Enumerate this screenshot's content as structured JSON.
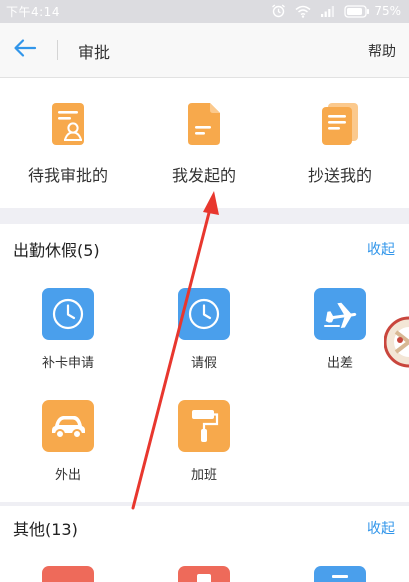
{
  "status_bar": {
    "time": "下午4:14",
    "battery": "75%",
    "icons": [
      "alarm-icon",
      "wifi-icon",
      "signal-icon",
      "battery-icon"
    ]
  },
  "header": {
    "title": "审批",
    "help": "帮助",
    "back_icon": "arrow-left-icon"
  },
  "quick_tabs": [
    {
      "label": "待我审批的",
      "icon": "pending-approval-icon"
    },
    {
      "label": "我发起的",
      "icon": "document-icon"
    },
    {
      "label": "抄送我的",
      "icon": "copy-documents-icon"
    }
  ],
  "sections": [
    {
      "title": "出勤休假(5)",
      "toggle": "收起",
      "items": [
        {
          "label": "补卡申请",
          "icon": "clock-icon"
        },
        {
          "label": "请假",
          "icon": "clock-icon"
        },
        {
          "label": "出差",
          "icon": "airplane-icon"
        },
        {
          "label": "外出",
          "icon": "car-icon"
        },
        {
          "label": "加班",
          "icon": "paint-roller-icon"
        }
      ]
    },
    {
      "title": "其他(13)",
      "toggle": "收起"
    }
  ],
  "colors": {
    "accent": "#3296ea",
    "orange": "#f7a94c",
    "blue_tile": "#4a9fec",
    "annotation": "#e8372e",
    "background": "#efeff4"
  }
}
